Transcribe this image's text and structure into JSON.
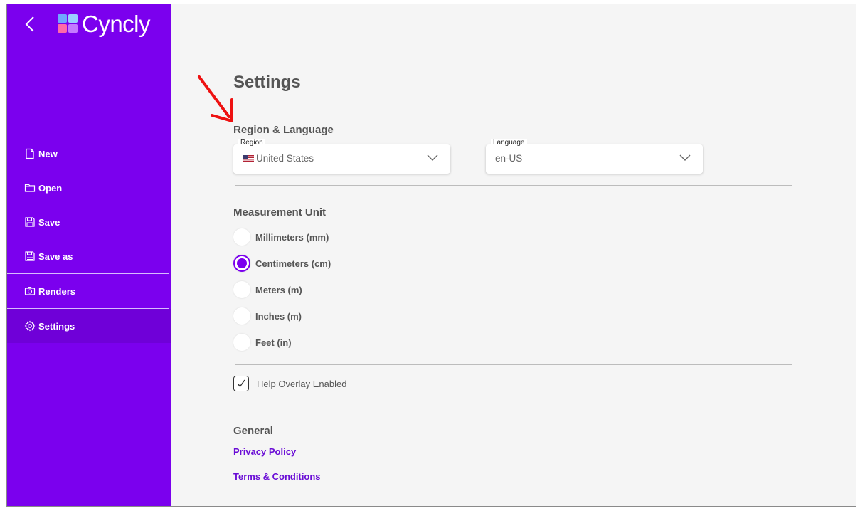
{
  "brand": {
    "name": "Cyncly"
  },
  "sidebar": {
    "items": [
      {
        "label": "New",
        "icon": "new-file-icon"
      },
      {
        "label": "Open",
        "icon": "folder-icon"
      },
      {
        "label": "Save",
        "icon": "save-icon"
      },
      {
        "label": "Save as",
        "icon": "save-as-icon"
      },
      {
        "label": "Renders",
        "icon": "camera-icon"
      },
      {
        "label": "Settings",
        "icon": "gear-icon",
        "active": true
      }
    ]
  },
  "settings": {
    "title": "Settings",
    "region_language": {
      "title": "Region & Language",
      "region": {
        "label": "Region",
        "value": "United States",
        "flag": "us-flag-icon"
      },
      "language": {
        "label": "Language",
        "value": "en-US"
      }
    },
    "measurement": {
      "title": "Measurement Unit",
      "options": [
        {
          "label": "Millimeters (mm)",
          "selected": false
        },
        {
          "label": "Centimeters (cm)",
          "selected": true
        },
        {
          "label": "Meters (m)",
          "selected": false
        },
        {
          "label": "Inches (m)",
          "selected": false
        },
        {
          "label": "Feet (in)",
          "selected": false
        }
      ]
    },
    "help_overlay": {
      "label": "Help Overlay Enabled",
      "checked": true
    },
    "general": {
      "title": "General",
      "links": [
        "Privacy Policy",
        "Terms & Conditions"
      ]
    }
  },
  "colors": {
    "sidebar": "#7b00ee",
    "accent": "#7b00ee",
    "link": "#6a0dd6",
    "annotation_arrow": "#ee1111"
  }
}
